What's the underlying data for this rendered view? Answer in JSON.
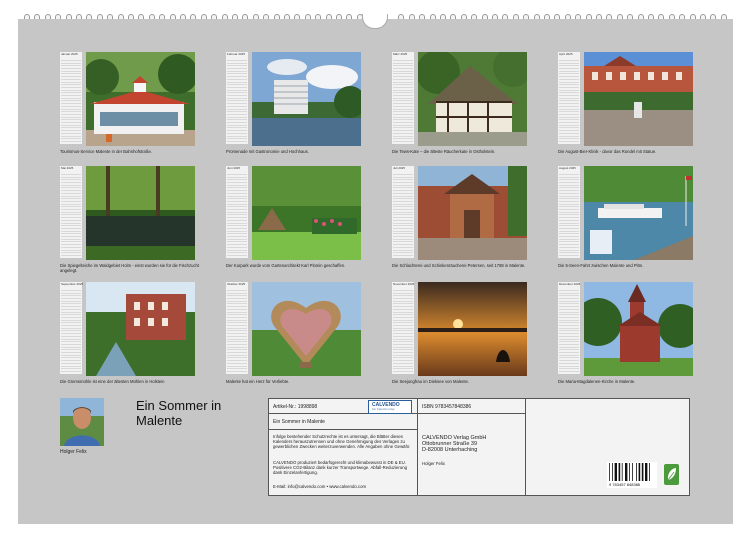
{
  "tiles": [
    {
      "month": "Januar 2025",
      "caption": "Tourismus-Service Malente in der Bahnhofstraße."
    },
    {
      "month": "Februar 2025",
      "caption": "Promenade mit Gastronomie und Hochhaus."
    },
    {
      "month": "März 2025",
      "caption": "Die Tews-Kate – die älteste Räucherkate in Ostholstein."
    },
    {
      "month": "April 2025",
      "caption": "Die August-Bier-Klinik - davor das Rondel mit Statue."
    },
    {
      "month": "Mai 2025",
      "caption": "Die Spiegelteiche im Waldgebiet Holm - einst wurden sie für die Fischzucht angelegt."
    },
    {
      "month": "Juni 2025",
      "caption": "Der Kurpark wurde vom Gartenarchitekt Karl Plomin geschaffen."
    },
    {
      "month": "Juli 2025",
      "caption": "Die Schlachterei und Schinkenräucherei Petersen, seit 1788 in Malente."
    },
    {
      "month": "August 2025",
      "caption": "Die 5-Seen-Fahrt zwischen Malente und Plön."
    },
    {
      "month": "September 2025",
      "caption": "Die Gremsmühle ist eine der ältesten Mühlen in Holstein"
    },
    {
      "month": "Oktober 2025",
      "caption": "Malente hat ein Herz für Verliebte."
    },
    {
      "month": "November 2025",
      "caption": "Die Seejungfrau im Dieksee von Malente."
    },
    {
      "month": "Dezember 2025",
      "caption": "Die Maria-Magdalenen-Kirche in Malente."
    }
  ],
  "footer": {
    "title_line1": "Ein Sommer in",
    "title_line2": "Malente",
    "author": "Holger Felix"
  },
  "info": {
    "article": "Artikel-Nr.: 1998898",
    "logo_name": "CALVENDO",
    "logo_sub": "Der Kalenderverlag",
    "isbn": "ISBN 9783457848386",
    "book_title": "Ein Sommer in Malente",
    "rights": "Infolge bestehender Schutzrechte ist es untersagt, die Blätter dieses Kalenders herauszutrennen und ohne Genehmigung des Verlages zu gewerblichen Zwecken weiterzuverwenden. Alle Angaben ohne Gewähr.",
    "production": "CALVENDO produziert bedarfsgerecht und klimabewusst in DE & EU. Positivere CO2-Bilanz dank kurzer Transportwege. Abfall-Reduzierung dank Einzelanfertigung.",
    "email": "E-Mail: info@calvendo.com • www.calvendo.com",
    "publisher": "CALVENDO Verlag GmbH",
    "street": "Ottobrunner Straße 39",
    "city": "D-82008 Unterhaching",
    "photographer": "Holger Felix",
    "barcode_text": "9 783457 848386"
  }
}
